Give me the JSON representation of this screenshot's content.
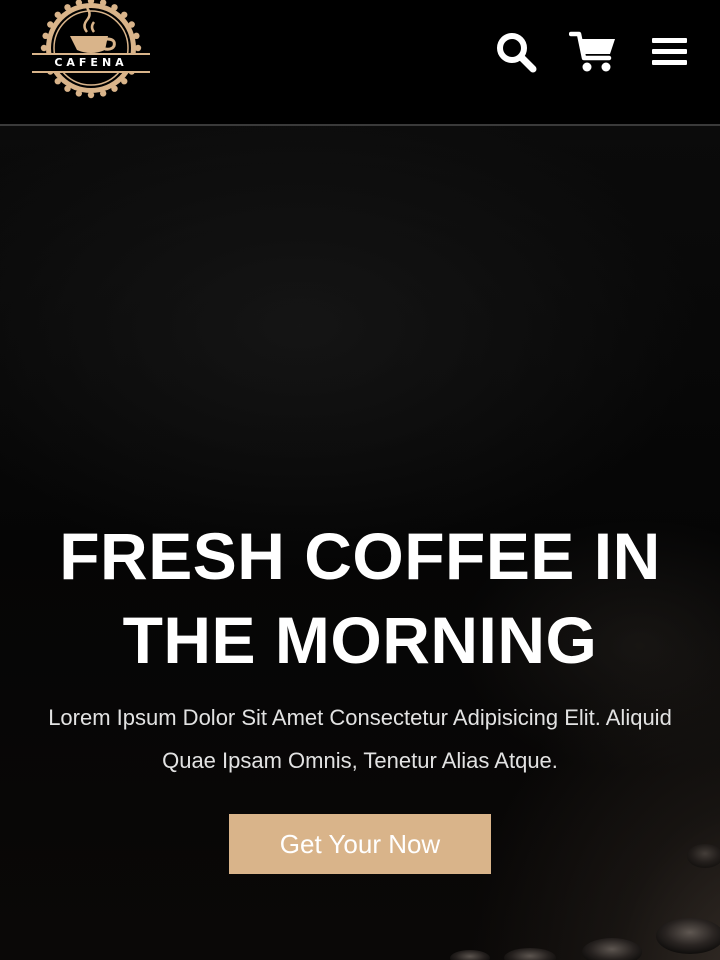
{
  "brand": {
    "logo_text": "CAFENA",
    "accent_color": "#d9b48a"
  },
  "header": {
    "icons": [
      "search-icon",
      "cart-icon",
      "menu-icon"
    ]
  },
  "hero": {
    "title": "FRESH COFFEE IN THE MORNING",
    "subtitle": "Lorem Ipsum Dolor Sit Amet Consectetur Adipisicing Elit. Aliquid Quae Ipsam Omnis, Tenetur Alias Atque.",
    "cta_label": "Get Your Now"
  }
}
